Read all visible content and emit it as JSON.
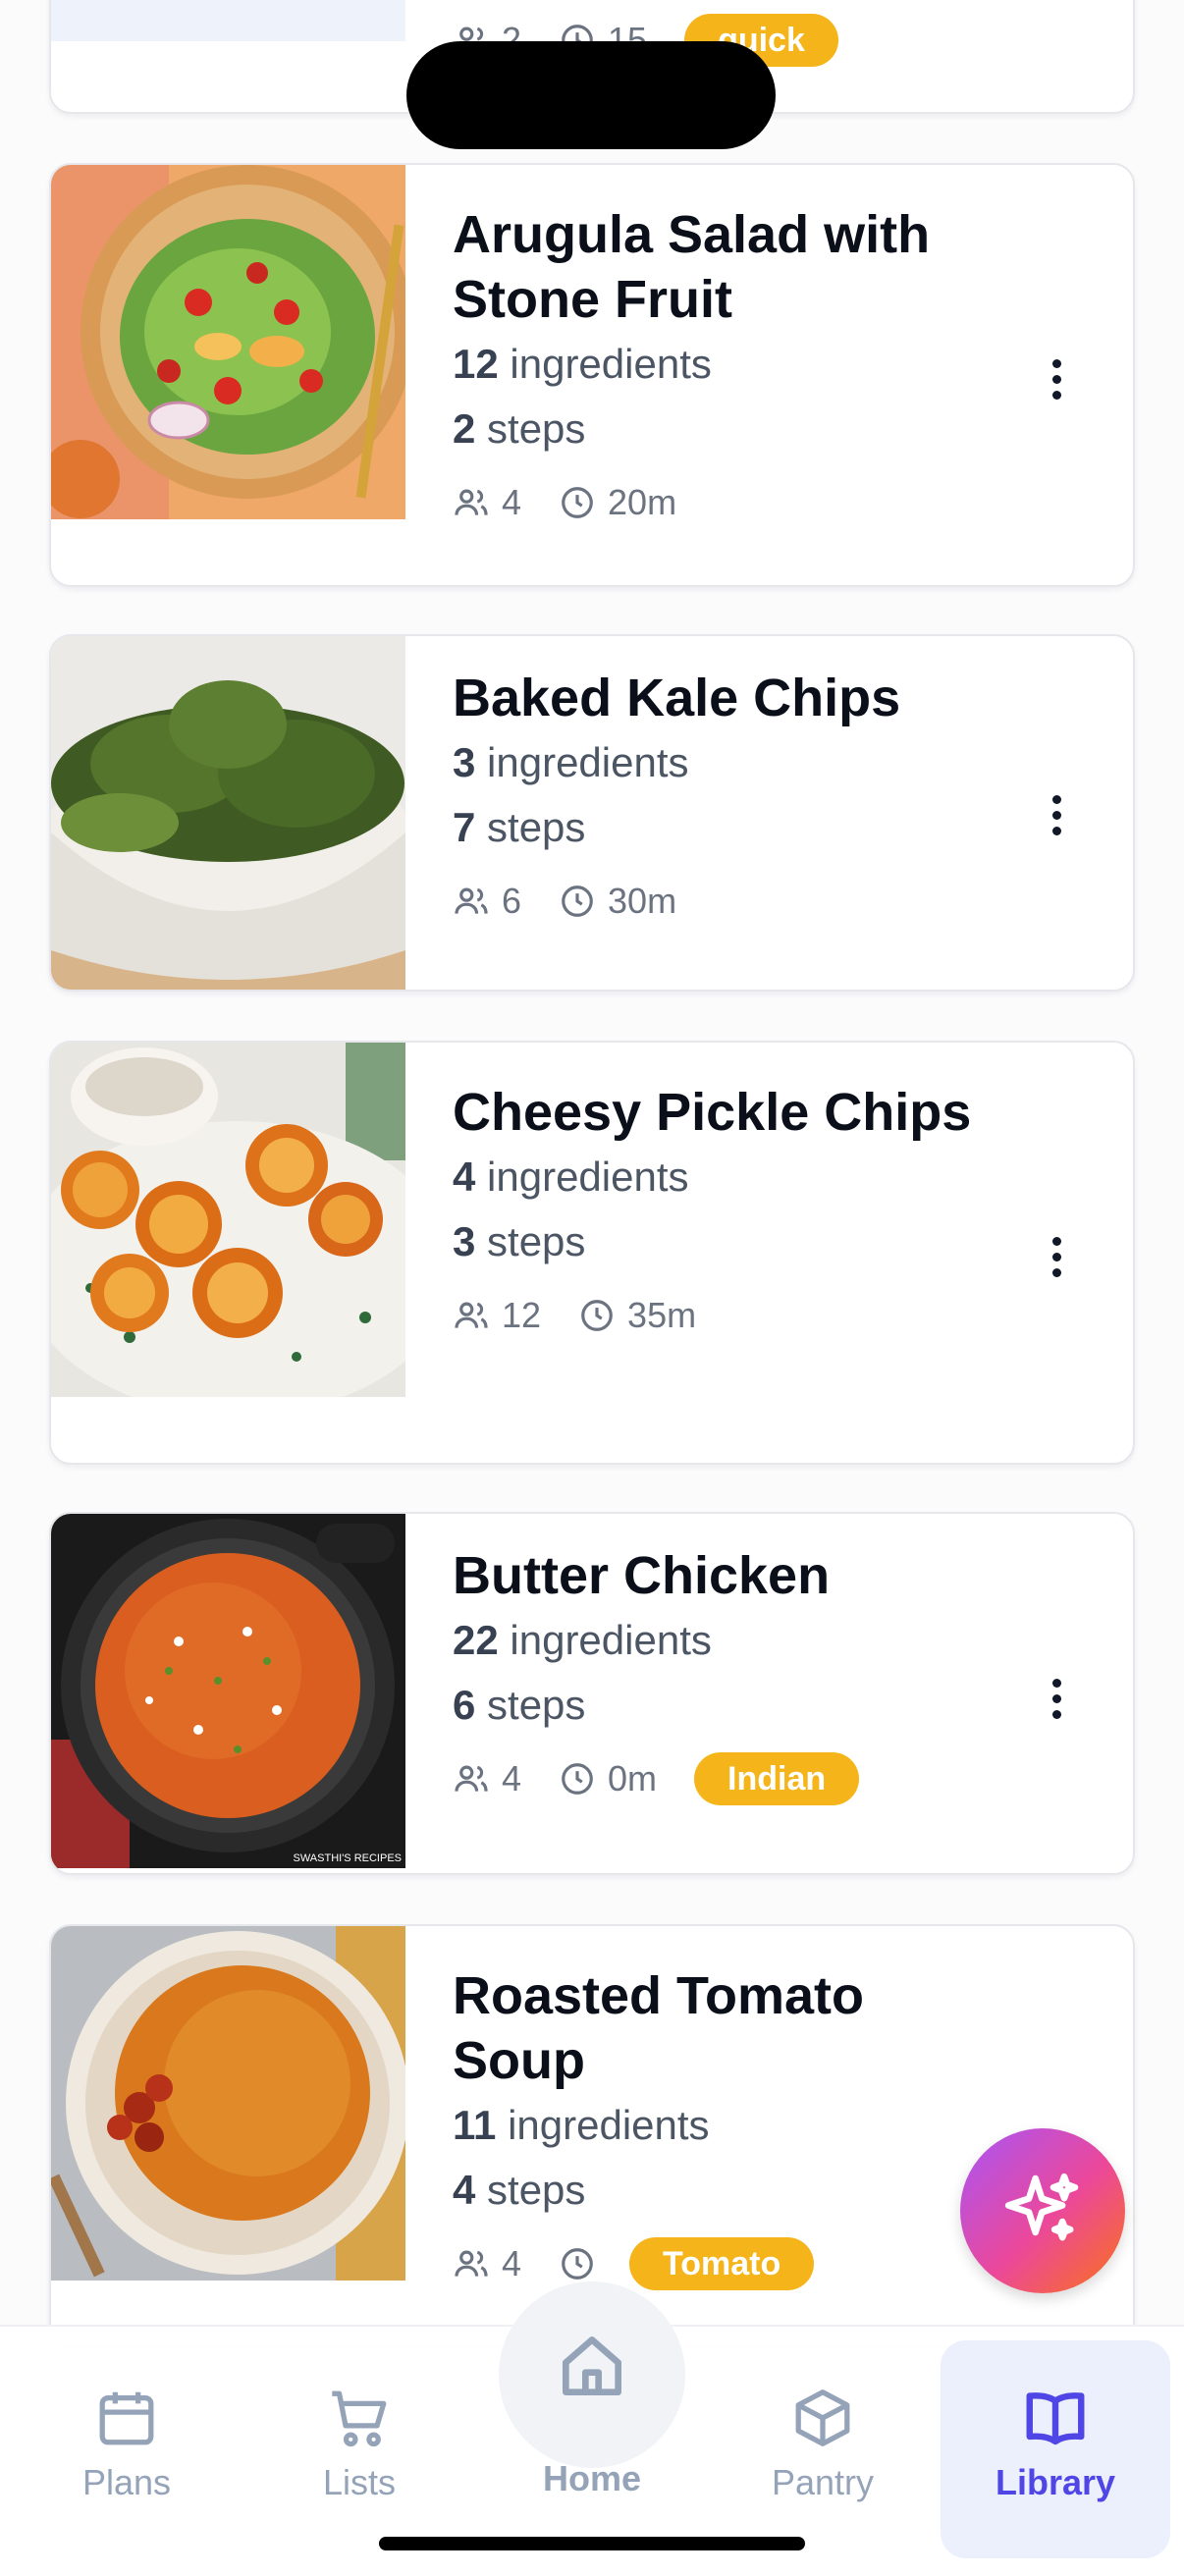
{
  "colors": {
    "accent": "#4f46e5",
    "tag": "#f4b41a",
    "inactive_nav": "#94a3b8"
  },
  "top_card": {
    "stat_people": "2",
    "stat_time": "15",
    "tag": "quick"
  },
  "recipes": [
    {
      "title": "Arugula Salad with Stone Fruit",
      "ingredients_count": "12",
      "ingredients_word": "ingredients",
      "steps_count": "2",
      "steps_word": "steps",
      "servings": "4",
      "time": "20m",
      "tag": ""
    },
    {
      "title": "Baked Kale Chips",
      "ingredients_count": "3",
      "ingredients_word": "ingredients",
      "steps_count": "7",
      "steps_word": "steps",
      "servings": "6",
      "time": "30m",
      "tag": ""
    },
    {
      "title": "Cheesy Pickle Chips",
      "ingredients_count": "4",
      "ingredients_word": "ingredients",
      "steps_count": "3",
      "steps_word": "steps",
      "servings": "12",
      "time": "35m",
      "tag": ""
    },
    {
      "title": "Butter Chicken",
      "ingredients_count": "22",
      "ingredients_word": "ingredients",
      "steps_count": "6",
      "steps_word": "steps",
      "servings": "4",
      "time": "0m",
      "tag": "Indian",
      "image_watermark": "SWASTHI'S RECIPES"
    },
    {
      "title": "Roasted Tomato Soup",
      "ingredients_count": "11",
      "ingredients_word": "ingredients",
      "steps_count": "4",
      "steps_word": "steps",
      "servings": "4",
      "time": "",
      "tag": "Tomato"
    }
  ],
  "nav": {
    "plans": "Plans",
    "lists": "Lists",
    "home": "Home",
    "pantry": "Pantry",
    "library": "Library",
    "active": "Library"
  },
  "icons": {
    "fab": "sparkle-icon",
    "more": "kebab-menu-icon",
    "servings": "people-icon",
    "time": "clock-icon"
  }
}
